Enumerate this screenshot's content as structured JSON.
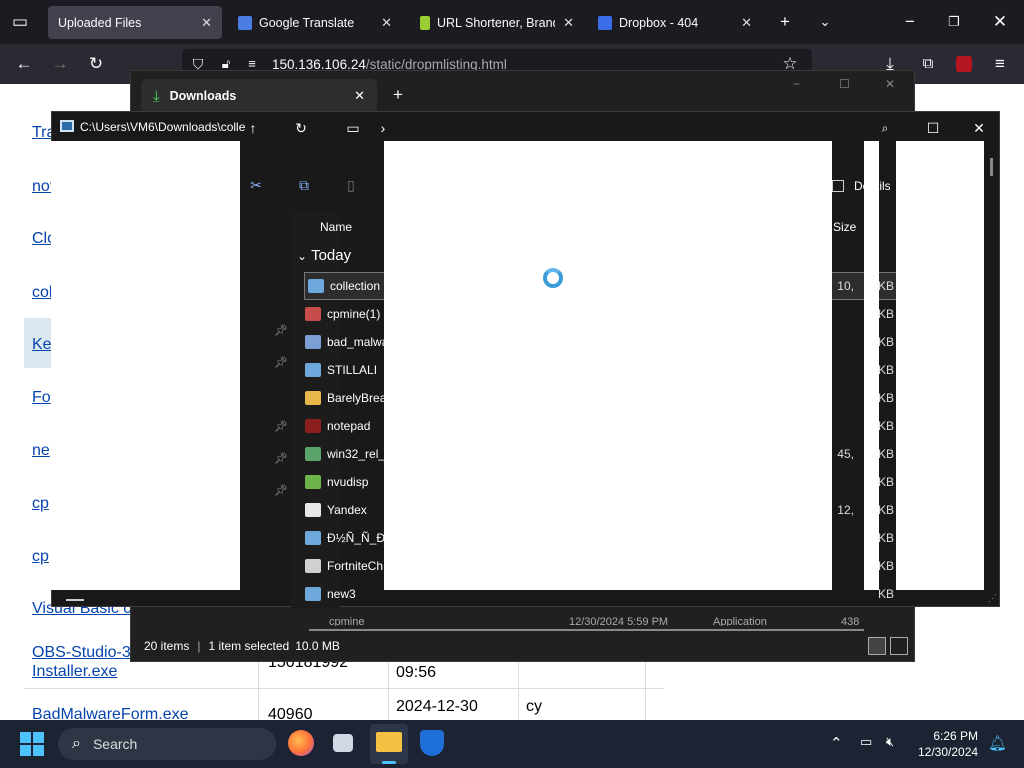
{
  "browser": {
    "tabs": [
      {
        "title": "Uploaded Files",
        "active": true
      },
      {
        "title": "Google Translate",
        "active": false
      },
      {
        "title": "URL Shortener, Brande",
        "active": false
      },
      {
        "title": "Dropbox - 404",
        "active": false
      }
    ],
    "url": {
      "host": "150.136.106.24",
      "path": "/static/dropmlisting.html"
    }
  },
  "webpage": {
    "links": [
      "Tra",
      "not",
      "Clo",
      "col",
      "Ke",
      "Fo",
      "ne",
      "cp",
      "cp",
      "Visual Basic c",
      "OBS-Studio-3",
      "Installer.exe",
      "BadMalwareForm.exe"
    ],
    "cells": {
      "obs_size": "150181992",
      "obs_time": "09:56",
      "bad_size": "40960",
      "bad_date": "2024-12-30",
      "bad_owner": "cy"
    }
  },
  "downloads_window": {
    "tab_title": "Downloads",
    "status": {
      "items": "20 items",
      "selected": "1 item selected",
      "size": "10.0 MB"
    },
    "partial_row": {
      "name": "cpmine",
      "date": "12/30/2024 5:59 PM",
      "type": "Application",
      "size": "438 KB"
    }
  },
  "explorer_window": {
    "path": "C:\\Users\\VM6\\Downloads\\colle",
    "toolbar": {
      "details_label": "Details"
    },
    "columns": {
      "name": "Name",
      "size": "Size"
    },
    "group": "Today",
    "files": [
      {
        "name": "collection",
        "icon": "app-window-icon",
        "size": "10,",
        "color": "#6fa8dc",
        "selected": true
      },
      {
        "name": "cpmine(1)",
        "icon": "installer-icon",
        "size": "",
        "color": "#c94c4c"
      },
      {
        "name": "bad_malwa",
        "icon": "document-icon",
        "size": "",
        "color": "#7b9fd4"
      },
      {
        "name": "STILLALI",
        "icon": "app-window-icon",
        "size": "",
        "color": "#6fa8dc"
      },
      {
        "name": "BarelyBrea",
        "icon": "folder-icon",
        "size": "",
        "color": "#e8b94a"
      },
      {
        "name": "notepad",
        "icon": "notepad-icon",
        "size": "",
        "color": "#8b1e1e"
      },
      {
        "name": "win32_rel_",
        "icon": "setup-icon",
        "size": "45,",
        "color": "#5aa36a"
      },
      {
        "name": "nvudisp",
        "icon": "nvidia-icon",
        "size": "",
        "color": "#6bb34a"
      },
      {
        "name": "Yandex",
        "icon": "yandex-icon",
        "size": "12,",
        "color": "#e8e8e8"
      },
      {
        "name": "Ð½Ñ_Ñ_Ð",
        "icon": "app-window-icon",
        "size": "",
        "color": "#6fa8dc"
      },
      {
        "name": "FortniteCh",
        "icon": "fortnite-icon",
        "size": "",
        "color": "#d0d0d0"
      },
      {
        "name": "new3",
        "icon": "app-window-icon",
        "size": "",
        "color": "#6fa8dc"
      }
    ],
    "size_suffix": "KB"
  },
  "taskbar": {
    "search_label": "Search",
    "time": "6:26 PM",
    "date": "12/30/2024"
  }
}
